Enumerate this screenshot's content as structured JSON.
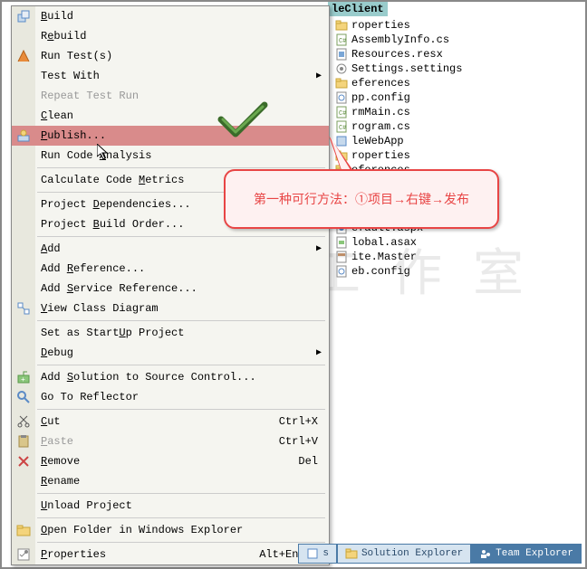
{
  "bg": {
    "header": "leClient",
    "items": [
      {
        "icon": "folder",
        "label": "roperties"
      },
      {
        "icon": "cs",
        "label": "AssemblyInfo.cs"
      },
      {
        "icon": "resx",
        "label": "Resources.resx"
      },
      {
        "icon": "settings",
        "label": "Settings.settings"
      },
      {
        "icon": "folder",
        "label": "eferences"
      },
      {
        "icon": "config",
        "label": "pp.config"
      },
      {
        "icon": "cs",
        "label": "rmMain.cs"
      },
      {
        "icon": "cs",
        "label": "rogram.cs"
      },
      {
        "icon": "proj",
        "label": "leWebApp"
      },
      {
        "icon": "folder",
        "label": "roperties"
      },
      {
        "icon": "folder",
        "label": "eferences"
      },
      {
        "icon": "",
        "label": ""
      },
      {
        "icon": "",
        "label": ""
      },
      {
        "icon": "",
        "label": ""
      },
      {
        "icon": "aspx",
        "label": "efault.aspx"
      },
      {
        "icon": "asax",
        "label": "lobal.asax"
      },
      {
        "icon": "master",
        "label": "ite.Master"
      },
      {
        "icon": "config",
        "label": "eb.config"
      }
    ]
  },
  "menu": {
    "items": [
      {
        "icon": "build",
        "label": "Build",
        "u": "B"
      },
      {
        "icon": "",
        "label": "Rebuild",
        "u": "e"
      },
      {
        "icon": "test",
        "label": "Run Test(s)"
      },
      {
        "icon": "",
        "label": "Test With",
        "arrow": true
      },
      {
        "icon": "",
        "label": "Repeat Test Run",
        "disabled": true
      },
      {
        "icon": "",
        "label": "Clean",
        "u": "C"
      },
      {
        "icon": "publish",
        "label": "Publish...",
        "u": "P",
        "highlight": true
      },
      {
        "icon": "",
        "label": "Run Code Analysis",
        "u": "A"
      },
      {
        "sep": true
      },
      {
        "icon": "",
        "label": "Calculate Code Metrics",
        "u": "M"
      },
      {
        "sep": true
      },
      {
        "icon": "",
        "label": "Project Dependencies...",
        "u": "D"
      },
      {
        "icon": "",
        "label": "Project Build Order...",
        "u": "B"
      },
      {
        "sep": true
      },
      {
        "icon": "",
        "label": "Add",
        "u": "A",
        "arrow": true
      },
      {
        "icon": "",
        "label": "Add Reference...",
        "u": "R"
      },
      {
        "icon": "",
        "label": "Add Service Reference...",
        "u": "S"
      },
      {
        "icon": "classdiag",
        "label": "View Class Diagram",
        "u": "V"
      },
      {
        "sep": true
      },
      {
        "icon": "",
        "label": "Set as StartUp Project",
        "u": "U"
      },
      {
        "icon": "",
        "label": "Debug",
        "u": "D",
        "arrow": true
      },
      {
        "sep": true
      },
      {
        "icon": "srcctrl",
        "label": "Add Solution to Source Control...",
        "u": "S"
      },
      {
        "icon": "reflector",
        "label": "Go To Reflector"
      },
      {
        "sep": true
      },
      {
        "icon": "cut",
        "label": "Cut",
        "u": "C",
        "shortcut": "Ctrl+X"
      },
      {
        "icon": "paste",
        "label": "Paste",
        "u": "P",
        "shortcut": "Ctrl+V",
        "disabled": true
      },
      {
        "icon": "remove",
        "label": "Remove",
        "u": "R",
        "shortcut": "Del"
      },
      {
        "icon": "",
        "label": "Rename",
        "u": "R"
      },
      {
        "sep": true
      },
      {
        "icon": "",
        "label": "Unload Project",
        "u": "U"
      },
      {
        "sep": true
      },
      {
        "icon": "folder",
        "label": "Open Folder in Windows Explorer",
        "u": "O"
      },
      {
        "sep": true
      },
      {
        "icon": "prop",
        "label": "Properties",
        "u": "P",
        "shortcut": "Alt+Enter"
      }
    ]
  },
  "callout": {
    "text": "第一种可行方法：①项目→右键→发布"
  },
  "tabs": {
    "items": [
      {
        "icon": "o",
        "label": "s",
        "state": "inactive"
      },
      {
        "icon": "se",
        "label": "Solution Explorer",
        "state": "inactive"
      },
      {
        "icon": "te",
        "label": "Team Explorer",
        "state": "active"
      }
    ]
  },
  "watermark": "邀 天 工 作 室"
}
